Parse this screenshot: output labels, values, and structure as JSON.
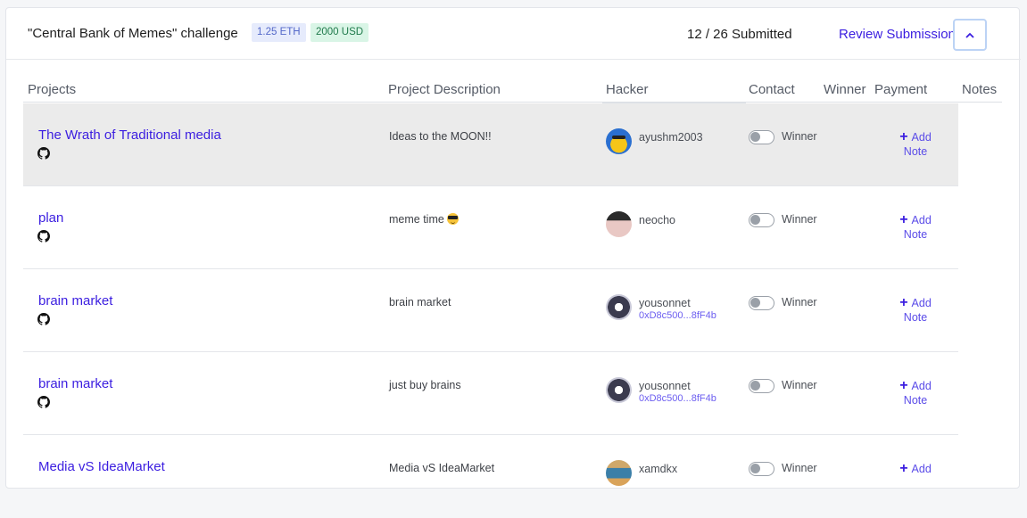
{
  "header": {
    "challenge_title": "\"Central Bank of Memes\" challenge",
    "eth_badge": "1.25 ETH",
    "usd_badge": "2000 USD",
    "submitted_text": "12 / 26 Submitted",
    "review_link": "Review Submission",
    "collapse_icon": "chevron-up-icon"
  },
  "columns": {
    "projects": "Projects",
    "description": "Project Description",
    "hacker": "Hacker",
    "contact": "Contact",
    "winner": "Winner",
    "payment": "Payment",
    "notes": "Notes"
  },
  "labels": {
    "winner_toggle": "Winner",
    "add_note_line1": "Add",
    "add_note_line2": "Note",
    "add_note_icon": "plus-icon"
  },
  "rows": [
    {
      "project": "The Wrath of Traditional media",
      "description": "Ideas to the MOON!!",
      "hacker": "ayushm2003",
      "wallet": "",
      "avatar": "duck-avatar"
    },
    {
      "project": "plan",
      "description": "meme time",
      "hacker": "neocho",
      "wallet": "",
      "avatar": "person-avatar"
    },
    {
      "project": "brain market",
      "description": "brain market",
      "hacker": "yousonnet",
      "wallet": "0xD8c500...8fF4b",
      "avatar": "robot-avatar"
    },
    {
      "project": "brain market",
      "description": "just buy brains",
      "hacker": "yousonnet",
      "wallet": "0xD8c500...8fF4b",
      "avatar": "robot-avatar"
    },
    {
      "project": "Media vS IdeaMarket",
      "description": "Media vS IdeaMarket",
      "hacker": "xamdkx",
      "wallet": "",
      "avatar": "mixed-avatar"
    }
  ],
  "colors": {
    "accent": "#3b1ee0",
    "active_row": "#ebebeb",
    "eth_badge_bg": "#e6ebfc",
    "usd_badge_bg": "#d9f5e6"
  }
}
